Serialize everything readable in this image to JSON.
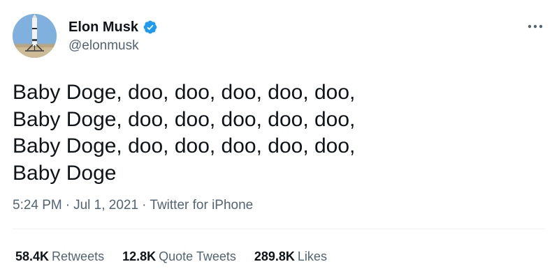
{
  "user": {
    "display_name": "Elon Musk",
    "handle": "@elonmusk",
    "verified_color": "#1d9bf0"
  },
  "tweet": {
    "text": "Baby Doge, doo, doo, doo, doo, doo,\nBaby Doge, doo, doo, doo, doo, doo,\nBaby Doge, doo, doo, doo, doo, doo,\nBaby Doge",
    "time": "5:24 PM",
    "date": "Jul 1, 2021",
    "source": "Twitter for iPhone",
    "separator": "·"
  },
  "stats": {
    "retweets": {
      "count": "58.4K",
      "label": "Retweets"
    },
    "quote_tweets": {
      "count": "12.8K",
      "label": "Quote Tweets"
    },
    "likes": {
      "count": "289.8K",
      "label": "Likes"
    }
  },
  "icons": {
    "more": "more-horizontal-icon",
    "verified": "verified-badge-icon"
  }
}
